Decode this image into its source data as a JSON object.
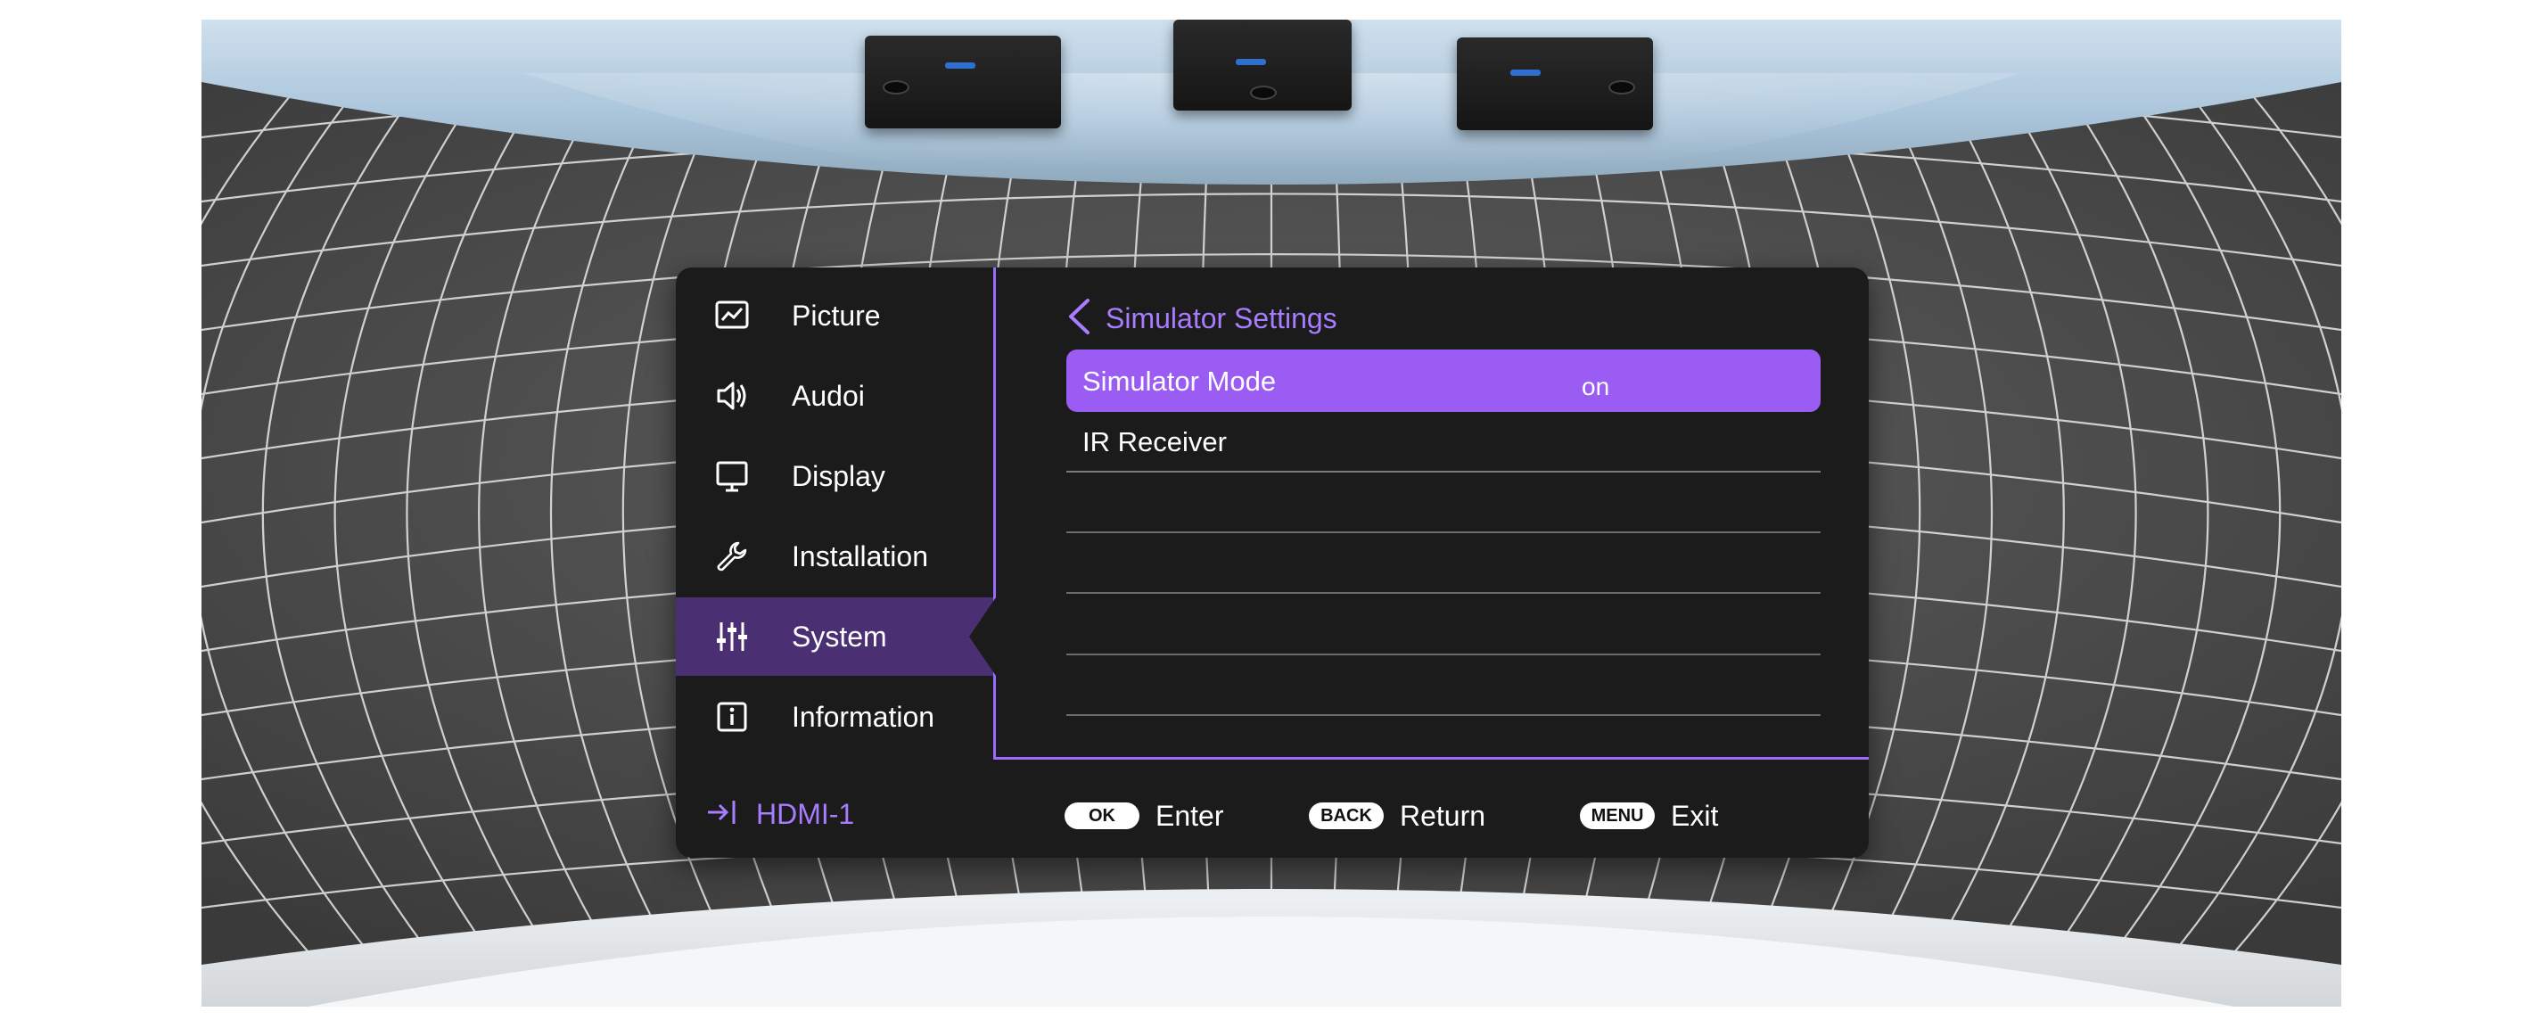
{
  "menu": {
    "items": [
      {
        "label": "Picture",
        "icon": "picture-chart-icon"
      },
      {
        "label": "Audoi",
        "icon": "speaker-icon"
      },
      {
        "label": "Display",
        "icon": "monitor-icon"
      },
      {
        "label": "Installation",
        "icon": "wrench-icon"
      },
      {
        "label": "System",
        "icon": "sliders-icon",
        "active": true
      },
      {
        "label": "Information",
        "icon": "info-icon"
      }
    ]
  },
  "page": {
    "title": "Simulator Settings",
    "rows": [
      {
        "label": "Simulator Mode",
        "value": "on",
        "selected": true
      },
      {
        "label": "IR Receiver",
        "value": ""
      }
    ]
  },
  "footer": {
    "source": "HDMI-1",
    "hints": [
      {
        "key": "OK",
        "label": "Enter"
      },
      {
        "key": "BACK",
        "label": "Return"
      },
      {
        "key": "MENU",
        "label": "Exit"
      }
    ]
  },
  "colors": {
    "accent": "#9a5cf2",
    "accent_text": "#a87cff",
    "active_nav": "#4a2f73",
    "panel": "#1b1b1b"
  }
}
